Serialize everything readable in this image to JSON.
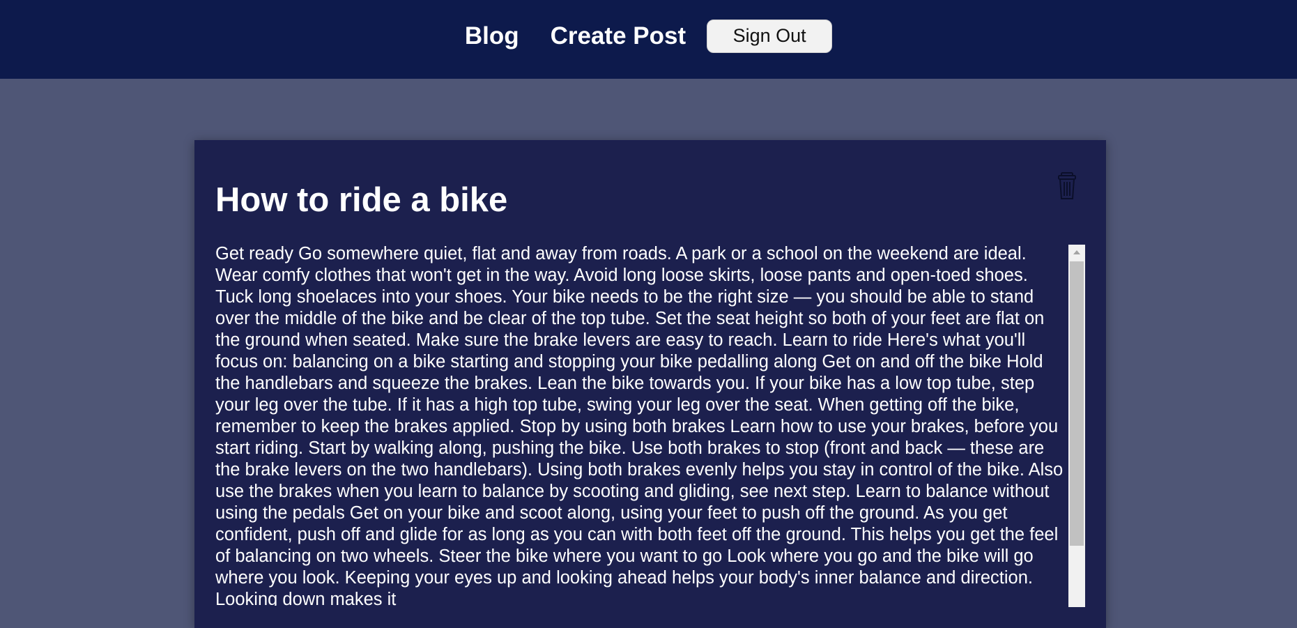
{
  "nav": {
    "blog_label": "Blog",
    "create_post_label": "Create Post",
    "sign_out_label": "Sign Out"
  },
  "post": {
    "title": "How to ride a bike",
    "body": "Get ready Go somewhere quiet, flat and away from roads. A park or a school on the weekend are ideal. Wear comfy clothes that won't get in the way. Avoid long loose skirts, loose pants and open-toed shoes. Tuck long shoelaces into your shoes. Your bike needs to be the right size — you should be able to stand over the middle of the bike and be clear of the top tube. Set the seat height so both of your feet are flat on the ground when seated. Make sure the brake levers are easy to reach. Learn to ride Here's what you'll focus on: balancing on a bike starting and stopping your bike pedalling along Get on and off the bike Hold the handlebars and squeeze the brakes. Lean the bike towards you. If your bike has a low top tube, step your leg over the tube. If it has a high top tube, swing your leg over the seat. When getting off the bike, remember to keep the brakes applied. Stop by using both brakes Learn how to use your brakes, before you start riding. Start by walking along, pushing the bike. Use both brakes to stop (front and back — these are the brake levers on the two handlebars). Using both brakes evenly helps you stay in control of the bike. Also use the brakes when you learn to balance by scooting and gliding, see next step. Learn to balance without using the pedals Get on your bike and scoot along, using your feet to push off the ground. As you get confident, push off and glide for as long as you can with both feet off the ground. This helps you get the feel of balancing on two wheels. Steer the bike where you want to go Look where you go and the bike will go where you look. Keeping your eyes up and looking ahead helps your body's inner balance and direction. Looking down makes it"
  },
  "icons": {
    "delete": "trash-icon",
    "scroll_up": "chevron-up-icon"
  },
  "colors": {
    "navbar_bg": "#0d1a4c",
    "page_bg": "#4f5676",
    "card_bg": "#1c204e"
  }
}
